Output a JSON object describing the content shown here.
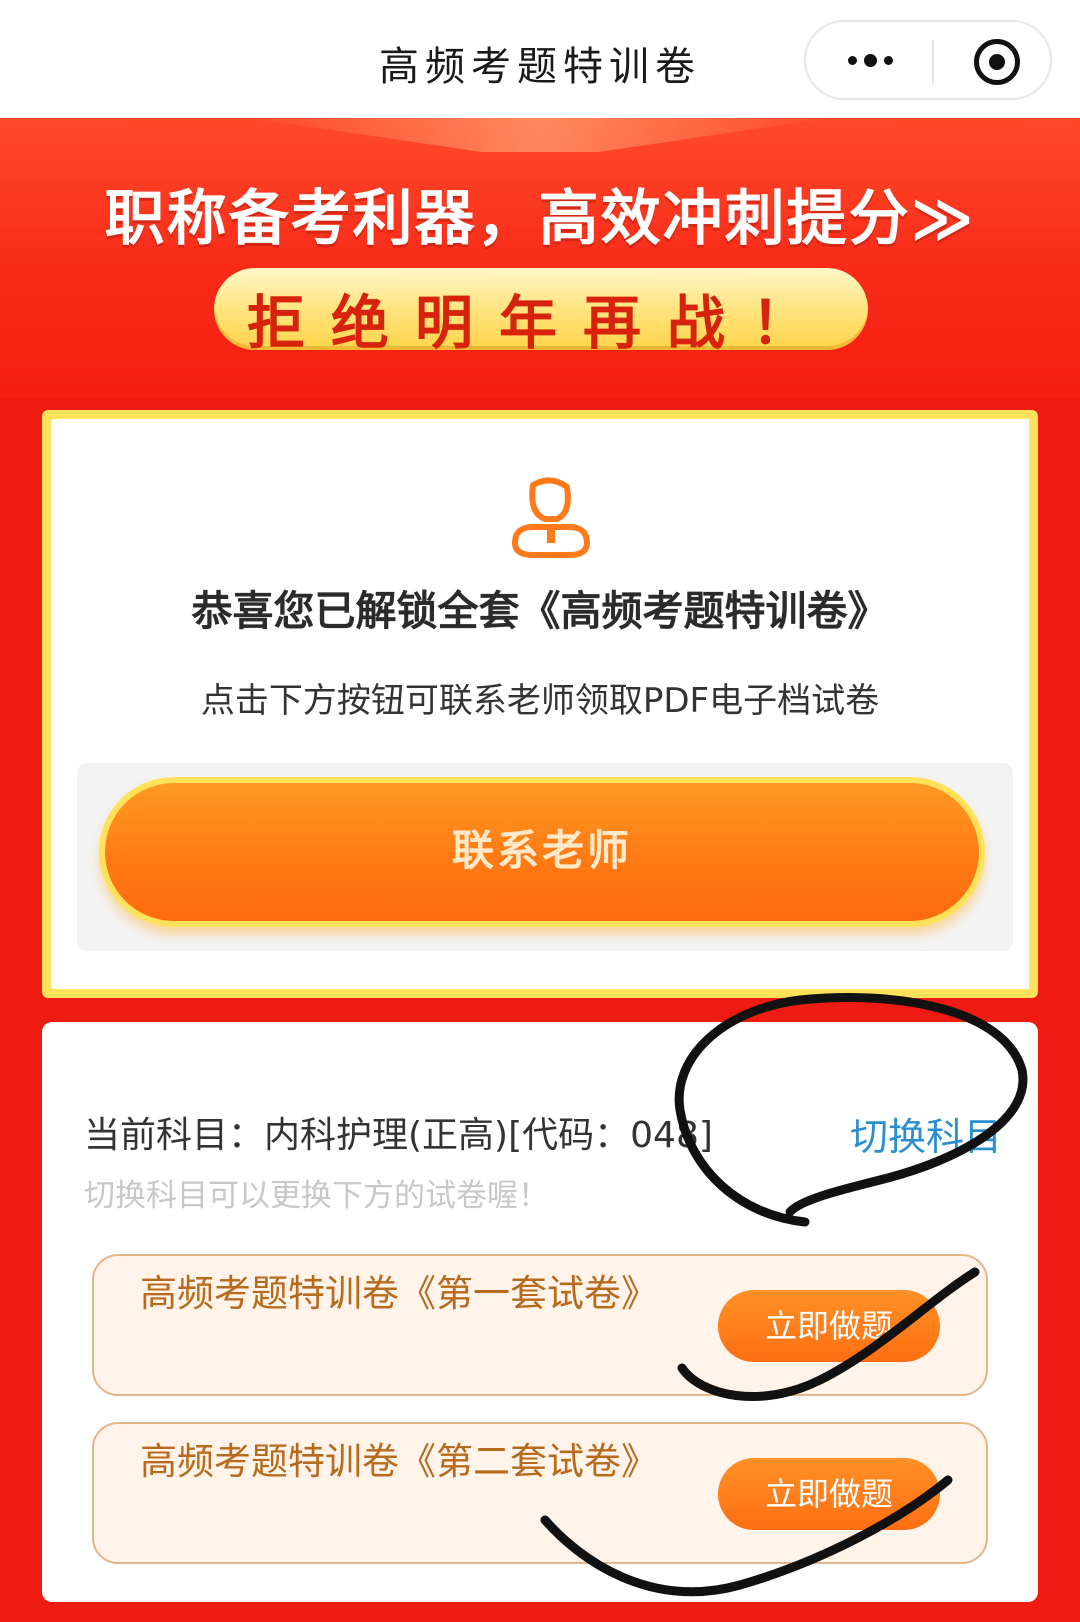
{
  "topbar": {
    "title": "高频考题特训卷",
    "more_icon": "more-dots-icon",
    "close_icon": "target-close-icon"
  },
  "banner": {
    "headline": "职称备考利器，高效冲刺提分≫",
    "slogan": "拒绝明年再战！"
  },
  "unlock_card": {
    "icon": "user-icon",
    "congrats": "恭喜您已解锁全套《高频考题特训卷》",
    "subtitle": "点击下方按钮可联系老师领取PDF电子档试卷",
    "contact_button": "联系老师"
  },
  "subject_card": {
    "current_subject": "当前科目：内科护理(正高)[代码：048]",
    "switch_label": "切换科目",
    "hint": "切换科目可以更换下方的试卷喔！",
    "papers": [
      {
        "title": "高频考题特训卷《第一套试卷》",
        "button": "立即做题"
      },
      {
        "title": "高频考题特训卷《第二套试卷》",
        "button": "立即做题"
      }
    ]
  },
  "colors": {
    "primary_red": "#ee1b12",
    "accent_orange": "#ff7a14",
    "accent_yellow": "#ffe15a",
    "link_blue": "#2b8fcf"
  }
}
